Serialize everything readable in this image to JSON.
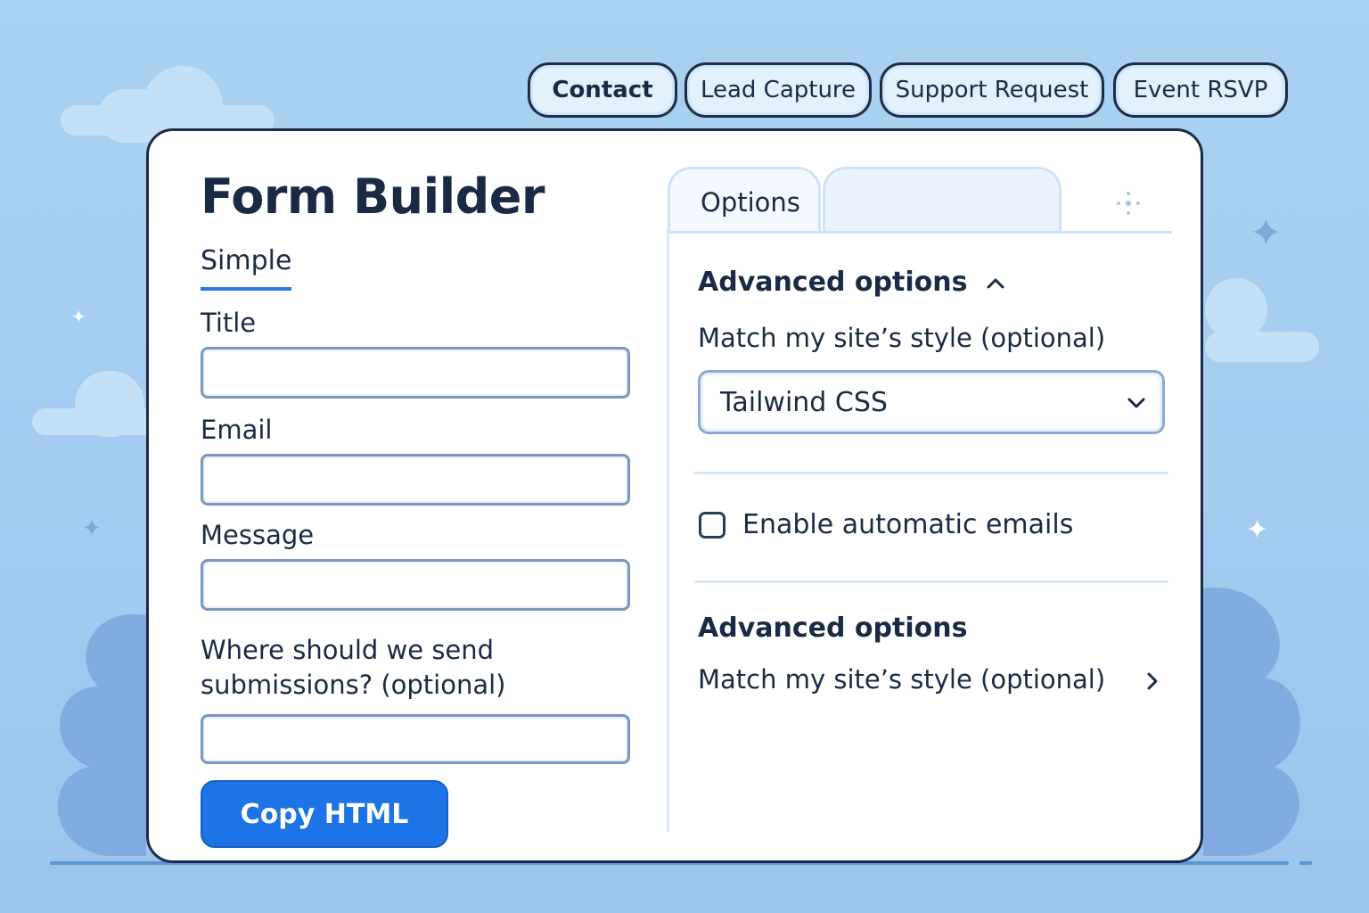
{
  "templates": [
    "Contact",
    "Lead Capture",
    "Support Request",
    "Event RSVP"
  ],
  "builder": {
    "title": "Form Builder",
    "mode_tab": "Simple",
    "fields": {
      "title_label": "Title",
      "title_value": "",
      "email_label": "Email",
      "email_value": "",
      "message_label": "Message",
      "message_value": "",
      "destination_label_line1": "Where should we send",
      "destination_label_line2": "submissions? (optional)",
      "destination_value": ""
    },
    "copy_button": "Copy HTML"
  },
  "options_panel": {
    "tab_label": "Options",
    "section1_heading": "Advanced options",
    "style_label": "Match my site’s style (optional)",
    "style_selected": "Tailwind CSS",
    "auto_email_label": "Enable automatic emails",
    "auto_email_checked": false,
    "section2_heading": "Advanced options",
    "section2_link": "Match my site’s style (optional)"
  },
  "colors": {
    "background": "#a9d1f1",
    "primary_button": "#1d74e6",
    "border_dark": "#1d2c47",
    "tab_underline": "#2a78e0"
  },
  "icons": [
    "chevron-up-icon",
    "chevron-down-icon",
    "chevron-right-icon",
    "move-icon",
    "sparkle-icon"
  ]
}
